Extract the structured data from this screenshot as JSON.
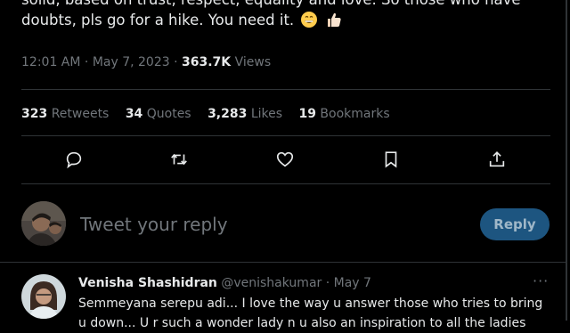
{
  "tweet": {
    "text_line1": "solid, based on trust, respect, equality and love. So those who have",
    "text_line2": "doubts, pls go for a hike. You need it.",
    "emoji": [
      "grinning-face-emoji",
      "thumbs-up-emoji"
    ]
  },
  "meta": {
    "time": "12:01 AM",
    "date": "May 7, 2023",
    "separator": "·",
    "views_count": "363.7K",
    "views_label": "Views"
  },
  "stats": {
    "retweets_count": "323",
    "retweets_label": "Retweets",
    "quotes_count": "34",
    "quotes_label": "Quotes",
    "likes_count": "3,283",
    "likes_label": "Likes",
    "bookmarks_count": "19",
    "bookmarks_label": "Bookmarks"
  },
  "actions": {
    "icons": [
      "reply-icon",
      "retweet-icon",
      "like-icon",
      "bookmark-icon",
      "share-icon"
    ]
  },
  "reply_box": {
    "placeholder": "Tweet your reply",
    "button_label": "Reply"
  },
  "comment": {
    "name": "Venisha Shashidran",
    "handle": "@venishakumar",
    "separator": "·",
    "date": "May 7",
    "more": "···",
    "text_line1": "Semmeyana serepu adi... I love the way u answer those who tries to bring",
    "text_line2": "u down... U r such a wonder lady n u also an inspiration to all the ladies"
  },
  "colors": {
    "background": "#000000",
    "text": "#e7e9ea",
    "muted": "#71767b",
    "divider": "#2f3336",
    "reply_button": "#1d5580"
  }
}
